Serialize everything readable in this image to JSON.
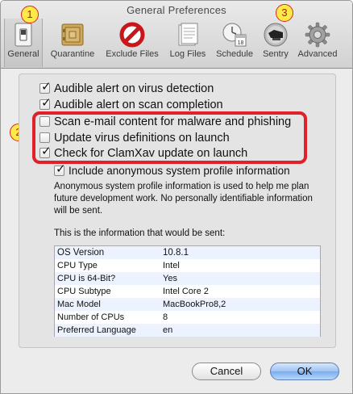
{
  "window": {
    "title": "General Preferences"
  },
  "toolbar": {
    "items": [
      {
        "label": "General",
        "icon": "switch-icon"
      },
      {
        "label": "Quarantine",
        "icon": "vault-icon"
      },
      {
        "label": "Exclude Files",
        "icon": "no-entry-icon"
      },
      {
        "label": "Log Files",
        "icon": "log-files-icon"
      },
      {
        "label": "Schedule",
        "icon": "calendar-clock-icon"
      },
      {
        "label": "Sentry",
        "icon": "sentry-icon"
      },
      {
        "label": "Advanced",
        "icon": "gear-icon"
      }
    ]
  },
  "callouts": [
    "1",
    "2",
    "3"
  ],
  "options": [
    {
      "label": "Audible alert on virus detection",
      "checked": true
    },
    {
      "label": "Audible alert on scan completion",
      "checked": true
    },
    {
      "label": "Scan e-mail content for malware and phishing",
      "checked": false
    },
    {
      "label": "Update virus definitions on launch",
      "checked": false
    },
    {
      "label": "Check for ClamXav update on launch",
      "checked": true
    },
    {
      "label": "Include anonymous system profile information",
      "checked": true
    }
  ],
  "description": "Anonymous system profile information is used to help me plan future development work. No personally identifiable information will be sent.",
  "info_caption": "This is the information that would be sent:",
  "info_table": [
    {
      "key": "OS Version",
      "value": "10.8.1"
    },
    {
      "key": "CPU Type",
      "value": "Intel"
    },
    {
      "key": "CPU is 64-Bit?",
      "value": "Yes"
    },
    {
      "key": "CPU Subtype",
      "value": "Intel Core 2"
    },
    {
      "key": "Mac Model",
      "value": "MacBookPro8,2"
    },
    {
      "key": "Number of CPUs",
      "value": "8"
    },
    {
      "key": "Preferred Language",
      "value": "en"
    }
  ],
  "buttons": {
    "cancel": "Cancel",
    "ok": "OK"
  },
  "colors": {
    "highlight": "#e0202a",
    "callout_fill": "#ffe84a",
    "callout_border": "#d4281c"
  }
}
